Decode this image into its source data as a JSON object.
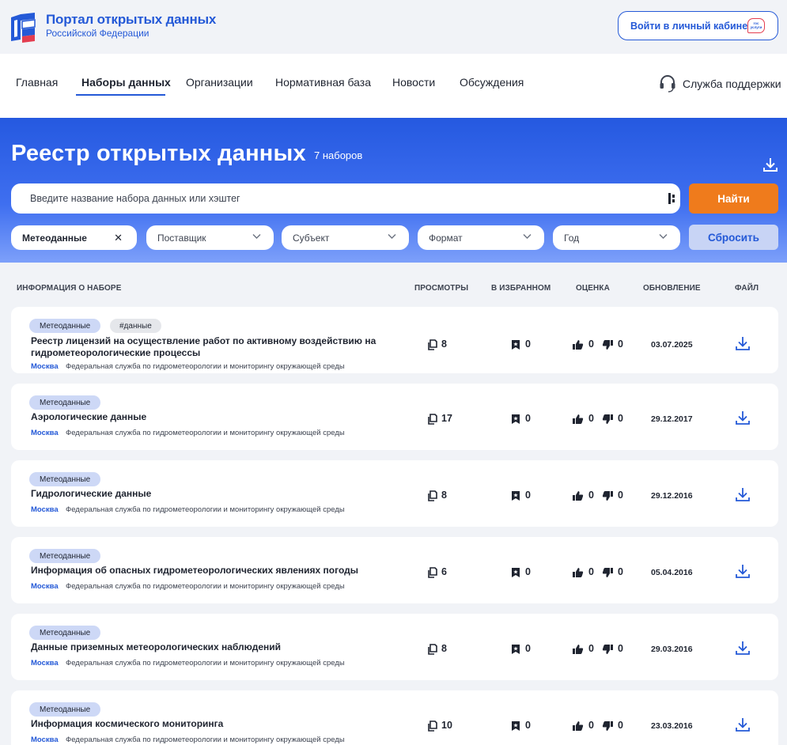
{
  "header": {
    "title": "Портал открытых данных",
    "subtitle": "Российской Федерации",
    "login_label": "Войти в личный кабинет",
    "gos_badge": "гос услуги"
  },
  "nav": {
    "items": [
      "Главная",
      "Наборы данных",
      "Организации",
      "Нормативная база",
      "Новости",
      "Обсуждения"
    ],
    "active": "Наборы данных",
    "support_label": "Служба поддержки"
  },
  "hero": {
    "title": "Реестр открытых данных",
    "count": "7 наборов",
    "search_placeholder": "Введите название набора данных или хэштег",
    "find_label": "Найти",
    "reset_label": "Сбросить",
    "filters": [
      "Метеоданные",
      "Поставщик",
      "Субъект",
      "Формат",
      "Год"
    ]
  },
  "table": {
    "columns": [
      "ИНФОРМАЦИЯ О НАБОРЕ",
      "ПРОСМОТРЫ",
      "В ИЗБРАННОМ",
      "ОЦЕНКА",
      "ОБНОВЛЕНИЕ",
      "ФАЙЛ"
    ],
    "rows": [
      {
        "tag": "Метеоданные",
        "hashtag": "#данные",
        "title": "Реестр лицензий на осуществление работ по активному воздействию на гидрометеорологические процессы",
        "city": "Москва",
        "org": "Федеральная служба по гидрометеорологии и мониторингу окружающей среды",
        "views": "8",
        "fav": "0",
        "likes": "0",
        "dislikes": "0",
        "date": "03.07.2025"
      },
      {
        "tag": "Метеоданные",
        "title": "Аэрологические данные",
        "city": "Москва",
        "org": "Федеральная служба по гидрометеорологии и мониторингу окружающей среды",
        "views": "17",
        "fav": "0",
        "likes": "0",
        "dislikes": "0",
        "date": "29.12.2017"
      },
      {
        "tag": "Метеоданные",
        "title": "Гидрологические данные",
        "city": "Москва",
        "org": "Федеральная служба по гидрометеорологии и мониторингу окружающей среды",
        "views": "8",
        "fav": "0",
        "likes": "0",
        "dislikes": "0",
        "date": "29.12.2016"
      },
      {
        "tag": "Метеоданные",
        "title": "Информация об опасных гидрометеорологических явлениях погоды",
        "city": "Москва",
        "org": "Федеральная служба по гидрометеорологии и мониторингу окружающей среды",
        "views": "6",
        "fav": "0",
        "likes": "0",
        "dislikes": "0",
        "date": "05.04.2016"
      },
      {
        "tag": "Метеоданные",
        "title": "Данные приземных метеорологических наблюдений",
        "city": "Москва",
        "org": "Федеральная служба по гидрометеорологии и мониторингу окружающей среды",
        "views": "8",
        "fav": "0",
        "likes": "0",
        "dislikes": "0",
        "date": "29.03.2016"
      },
      {
        "tag": "Метеоданные",
        "title": "Информация космического мониторинга",
        "city": "Москва",
        "org": "Федеральная служба по гидрометеорологии и мониторингу окружающей среды",
        "views": "10",
        "fav": "0",
        "likes": "0",
        "dislikes": "0",
        "date": "23.03.2016"
      }
    ]
  },
  "colors": {
    "accent": "#2459d7",
    "orange": "#ef7b1c",
    "tag": "#cdd8f6"
  }
}
